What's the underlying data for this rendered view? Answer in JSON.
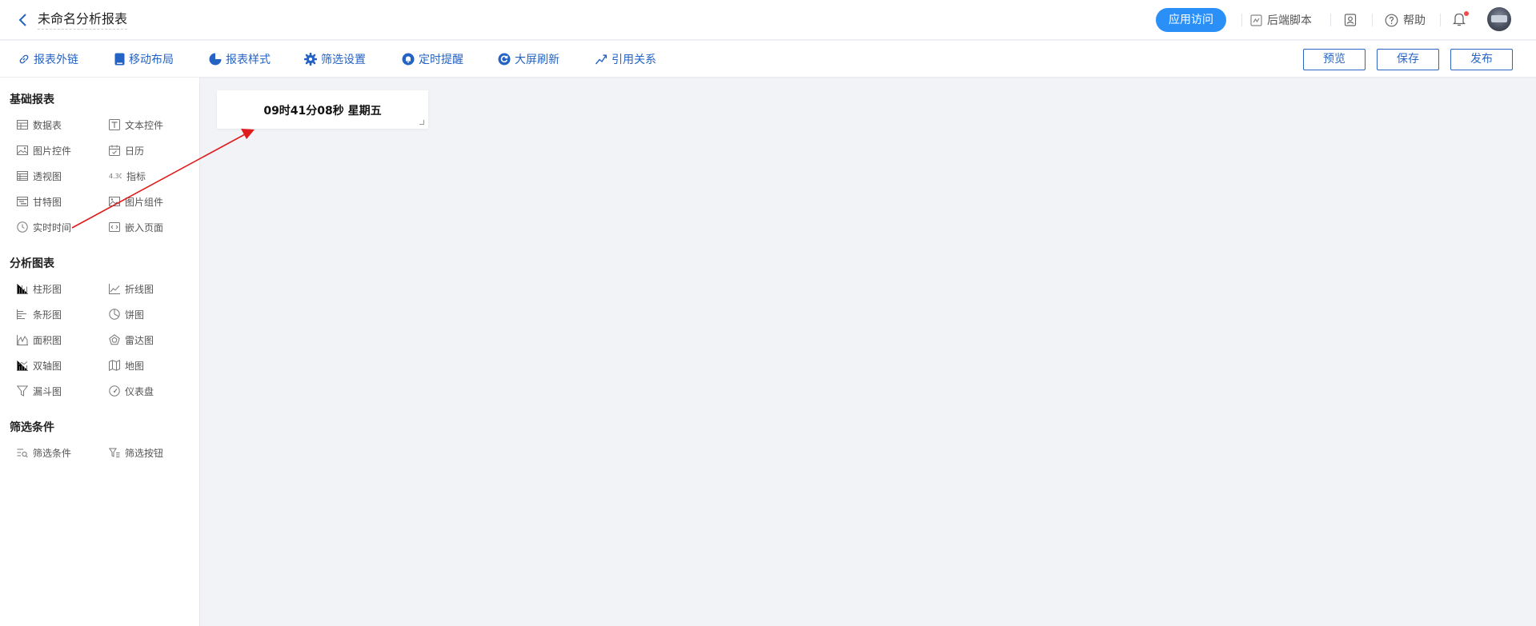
{
  "header": {
    "title": "未命名分析报表",
    "visit_label": "应用访问",
    "backend_script_label": "后端脚本",
    "help_label": "帮助"
  },
  "toolbar": {
    "tools": {
      "external_link": "报表外链",
      "mobile_layout": "移动布局",
      "report_style": "报表样式",
      "filter_settings": "筛选设置",
      "scheduled_reminder": "定时提醒",
      "screen_refresh": "大屏刷新",
      "references": "引用关系"
    },
    "preview_label": "预览",
    "save_label": "保存",
    "publish_label": "发布"
  },
  "sidebar": {
    "basic": {
      "title": "基础报表",
      "data_table": "数据表",
      "text_control": "文本控件",
      "image_control": "图片控件",
      "calendar": "日历",
      "pivot": "透视图",
      "indicator": "指标",
      "gantt": "甘特图",
      "image_group": "图片组件",
      "realtime": "实时时间",
      "embed_page": "嵌入页面"
    },
    "analysis": {
      "title": "分析图表",
      "bar": "柱形图",
      "line": "折线图",
      "hbar": "条形图",
      "pie": "饼图",
      "area": "面积图",
      "radar": "雷达图",
      "dual_axis": "双轴图",
      "map": "地图",
      "funnel": "漏斗图",
      "gauge": "仪表盘"
    },
    "filter": {
      "title": "筛选条件",
      "condition": "筛选条件",
      "button": "筛选按钮"
    }
  },
  "canvas": {
    "time_widget_text": "09时41分08秒 星期五"
  },
  "colors": {
    "accent": "#2a8ff7",
    "link_blue": "#2463c4",
    "annotation_arrow": "#e01b1b"
  }
}
